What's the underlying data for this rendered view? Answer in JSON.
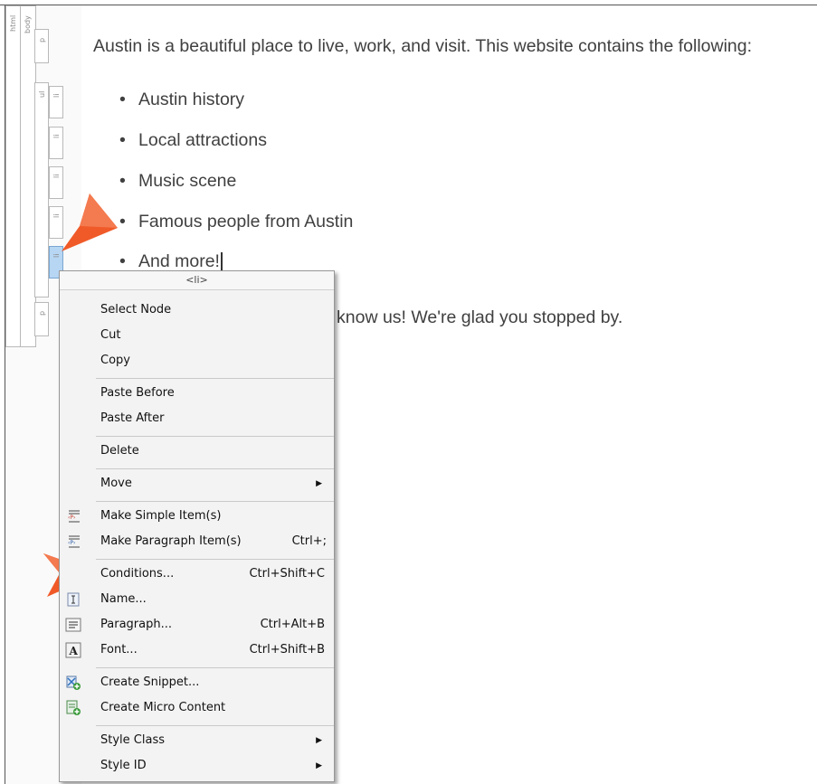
{
  "structure_bars": {
    "html_label": "html",
    "body_label": "body",
    "p_tag": "p",
    "ul_tag": "ul",
    "li_tag": "li"
  },
  "document": {
    "intro": "Austin is a beautiful place to live, work, and visit. This website contains the following:",
    "list_items": [
      "Austin history",
      "Local attractions",
      "Music scene",
      "Famous people from Austin",
      "And more!"
    ],
    "closing": "know us! We're glad you stopped by."
  },
  "context_menu": {
    "header": "<li>",
    "items": [
      {
        "label": "Select Node",
        "shortcut": ""
      },
      {
        "label": "Cut",
        "shortcut": ""
      },
      {
        "label": "Copy",
        "shortcut": ""
      },
      {
        "label": "Paste Before",
        "shortcut": ""
      },
      {
        "label": "Paste After",
        "shortcut": ""
      },
      {
        "label": "Delete",
        "shortcut": ""
      },
      {
        "label": "Move",
        "shortcut": ""
      },
      {
        "label": "Make Simple Item(s)",
        "shortcut": ""
      },
      {
        "label": "Make Paragraph Item(s)",
        "shortcut": "Ctrl+;"
      },
      {
        "label": "Conditions...",
        "shortcut": "Ctrl+Shift+C"
      },
      {
        "label": "Name...",
        "shortcut": ""
      },
      {
        "label": "Paragraph...",
        "shortcut": "Ctrl+Alt+B"
      },
      {
        "label": "Font...",
        "shortcut": "Ctrl+Shift+B"
      },
      {
        "label": "Create Snippet...",
        "shortcut": ""
      },
      {
        "label": "Create Micro Content",
        "shortcut": ""
      },
      {
        "label": "Style Class",
        "shortcut": ""
      },
      {
        "label": "Style ID",
        "shortcut": ""
      }
    ],
    "icons": {
      "make_simple": "simple-item-icon",
      "make_paragraph": "paragraph-item-icon",
      "conditions": "conditions-icon",
      "name": "name-icon",
      "paragraph": "paragraph-icon",
      "font": "font-icon",
      "snippet": "create-snippet-icon",
      "micro": "micro-content-icon"
    },
    "submenu_arrow": "▶"
  },
  "colors": {
    "pointer": "#f05a28",
    "selection": "#b7d6f3",
    "text": "#404040"
  }
}
